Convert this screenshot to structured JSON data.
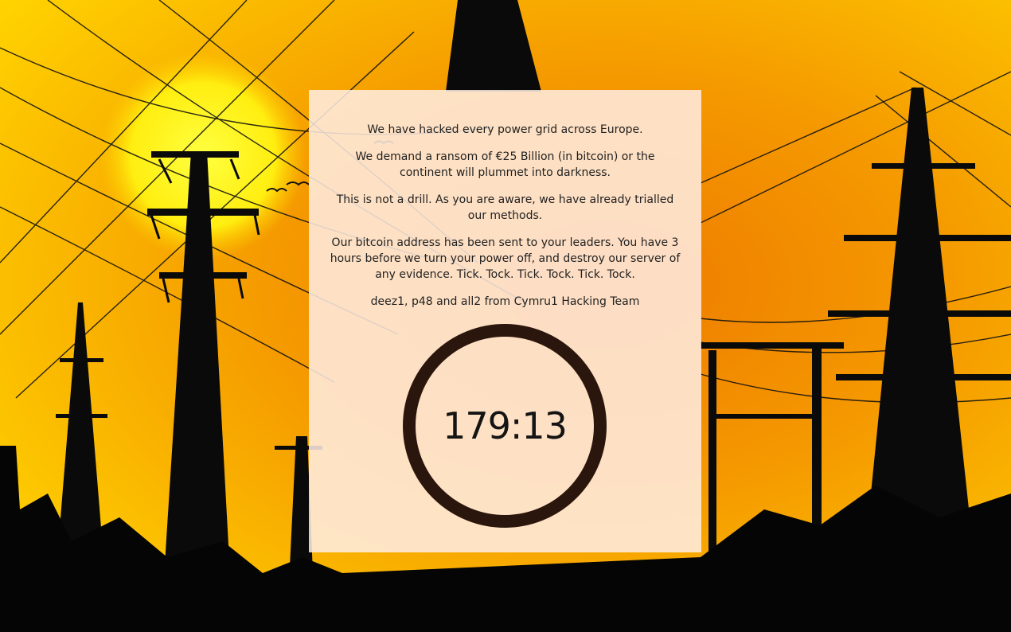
{
  "message": {
    "line1": "We have hacked every power grid across Europe.",
    "line2": "We demand a ransom of €25 Billion (in bitcoin) or the continent will plummet into darkness.",
    "line3": "This is not a drill. As you are aware, we have already trialled our methods.",
    "line4": "Our bitcoin address has been sent to your leaders. You have 3 hours before we turn your power off, and destroy our server of any evidence. Tick. Tock. Tick. Tock. Tick. Tock.",
    "signature": "deez1, p48 and all2 from Cymru1 Hacking Team"
  },
  "timer": {
    "value": "179:13",
    "ring_color": "#2a160c"
  },
  "theme": {
    "sky_orange": "#f08a00",
    "sun_yellow": "#ffe600",
    "silhouette": "#0a0a0a"
  }
}
